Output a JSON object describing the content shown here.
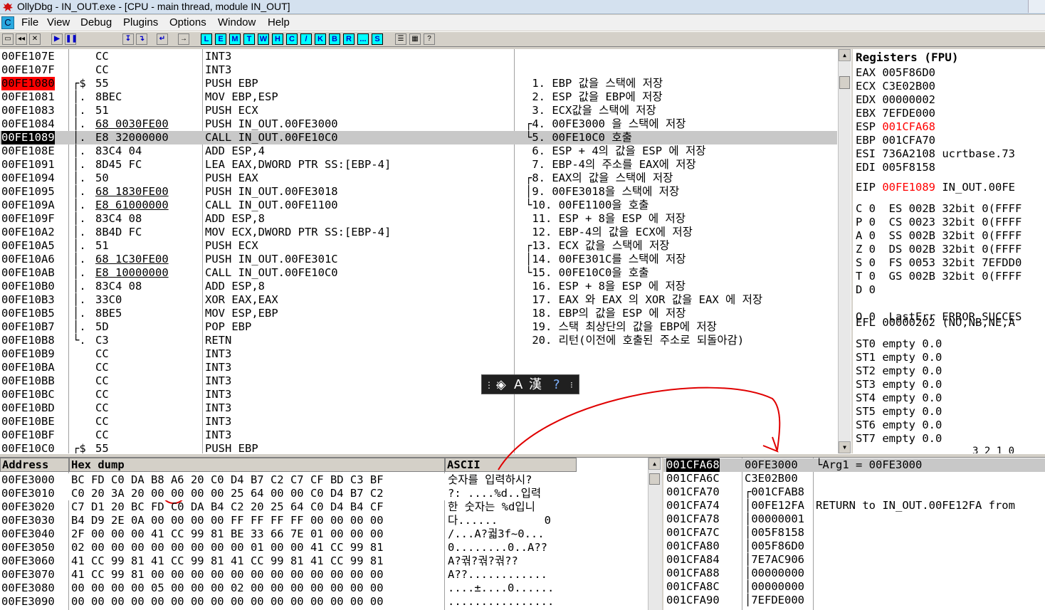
{
  "window": {
    "title": "OllyDbg - IN_OUT.exe - [CPU - main thread, module IN_OUT]"
  },
  "menu": [
    "File",
    "View",
    "Debug",
    "Plugins",
    "Options",
    "Window",
    "Help"
  ],
  "menu_cpu_label": "C",
  "toolbar_letters": [
    "L",
    "E",
    "M",
    "T",
    "W",
    "H",
    "C",
    "/",
    "K",
    "B",
    "R",
    "...",
    "S"
  ],
  "toolbar_tail": [
    "?"
  ],
  "disasm": [
    {
      "addr": "00FE107E",
      "mark": "",
      "hex": "CC",
      "dis": "INT3",
      "cmt": ""
    },
    {
      "addr": "00FE107F",
      "mark": "",
      "hex": "CC",
      "dis": "INT3",
      "cmt": ""
    },
    {
      "addr": "00FE1080",
      "mark": "┌$",
      "hex": "55",
      "dis": "PUSH EBP",
      "cmt": " 1. EBP 값을 스택에 저장"
    },
    {
      "addr": "00FE1081",
      "mark": "│.",
      "hex": "8BEC",
      "dis": "MOV EBP,ESP",
      "cmt": " 2. ESP 값을 EBP에 저장"
    },
    {
      "addr": "00FE1083",
      "mark": "│.",
      "hex": "51",
      "dis": "PUSH ECX",
      "cmt": " 3. ECX값을 스택에 저장"
    },
    {
      "addr": "00FE1084",
      "mark": "│.",
      "hex": "68 0030FE00",
      "dis": "PUSH IN_OUT.00FE3000",
      "cmt": "┌4. 00FE3000 을 스택에 저장"
    },
    {
      "addr": "00FE1089",
      "mark": "│.",
      "hex": "E8 32000000",
      "dis": "CALL IN_OUT.00FE10C0",
      "cmt": "└5. 00FE10C0 호출"
    },
    {
      "addr": "00FE108E",
      "mark": "│.",
      "hex": "83C4 04",
      "dis": "ADD ESP,4",
      "cmt": " 6. ESP + 4의 값을 ESP 에 저장"
    },
    {
      "addr": "00FE1091",
      "mark": "│.",
      "hex": "8D45 FC",
      "dis": "LEA EAX,DWORD PTR SS:[EBP-4]",
      "cmt": " 7. EBP-4의 주소를 EAX에 저장"
    },
    {
      "addr": "00FE1094",
      "mark": "│.",
      "hex": "50",
      "dis": "PUSH EAX",
      "cmt": "┌8. EAX의 값을 스택에 저장"
    },
    {
      "addr": "00FE1095",
      "mark": "│.",
      "hex": "68 1830FE00",
      "dis": "PUSH IN_OUT.00FE3018",
      "cmt": "│9. 00FE3018을 스택에 저장"
    },
    {
      "addr": "00FE109A",
      "mark": "│.",
      "hex": "E8 61000000",
      "dis": "CALL IN_OUT.00FE1100",
      "cmt": "└10. 00FE1100을 호출"
    },
    {
      "addr": "00FE109F",
      "mark": "│.",
      "hex": "83C4 08",
      "dis": "ADD ESP,8",
      "cmt": " 11. ESP + 8을 ESP 에 저장"
    },
    {
      "addr": "00FE10A2",
      "mark": "│.",
      "hex": "8B4D FC",
      "dis": "MOV ECX,DWORD PTR SS:[EBP-4]",
      "cmt": " 12. EBP-4의 값을 ECX에 저장"
    },
    {
      "addr": "00FE10A5",
      "mark": "│.",
      "hex": "51",
      "dis": "PUSH ECX",
      "cmt": "┌13. ECX 값을 스택에 저장"
    },
    {
      "addr": "00FE10A6",
      "mark": "│.",
      "hex": "68 1C30FE00",
      "dis": "PUSH IN_OUT.00FE301C",
      "cmt": "│14. 00FE301C를 스택에 저장"
    },
    {
      "addr": "00FE10AB",
      "mark": "│.",
      "hex": "E8 10000000",
      "dis": "CALL IN_OUT.00FE10C0",
      "cmt": "└15. 00FE10C0을 호출"
    },
    {
      "addr": "00FE10B0",
      "mark": "│.",
      "hex": "83C4 08",
      "dis": "ADD ESP,8",
      "cmt": " 16. ESP + 8을 ESP 에 저장"
    },
    {
      "addr": "00FE10B3",
      "mark": "│.",
      "hex": "33C0",
      "dis": "XOR EAX,EAX",
      "cmt": " 17. EAX 와 EAX 의 XOR 값을 EAX 에 저장"
    },
    {
      "addr": "00FE10B5",
      "mark": "│.",
      "hex": "8BE5",
      "dis": "MOV ESP,EBP",
      "cmt": " 18. EBP의 값을 ESP 에 저장"
    },
    {
      "addr": "00FE10B7",
      "mark": "│.",
      "hex": "5D",
      "dis": "POP EBP",
      "cmt": " 19. 스택 최상단의 값을 EBP에 저장"
    },
    {
      "addr": "00FE10B8",
      "mark": "└.",
      "hex": "C3",
      "dis": "RETN",
      "cmt": " 20. 리턴(이전에 호출된 주소로 되돌아감)"
    },
    {
      "addr": "00FE10B9",
      "mark": "",
      "hex": "CC",
      "dis": "INT3",
      "cmt": ""
    },
    {
      "addr": "00FE10BA",
      "mark": "",
      "hex": "CC",
      "dis": "INT3",
      "cmt": ""
    },
    {
      "addr": "00FE10BB",
      "mark": "",
      "hex": "CC",
      "dis": "INT3",
      "cmt": ""
    },
    {
      "addr": "00FE10BC",
      "mark": "",
      "hex": "CC",
      "dis": "INT3",
      "cmt": ""
    },
    {
      "addr": "00FE10BD",
      "mark": "",
      "hex": "CC",
      "dis": "INT3",
      "cmt": ""
    },
    {
      "addr": "00FE10BE",
      "mark": "",
      "hex": "CC",
      "dis": "INT3",
      "cmt": ""
    },
    {
      "addr": "00FE10BF",
      "mark": "",
      "hex": "CC",
      "dis": "INT3",
      "cmt": ""
    },
    {
      "addr": "00FE10C0",
      "mark": "┌$",
      "hex": "55",
      "dis": "PUSH EBP",
      "cmt": ""
    }
  ],
  "registers": {
    "title": "Registers (FPU)",
    "gp": [
      {
        "name": "EAX",
        "value": "005F86D0",
        "extra": "",
        "changed": false
      },
      {
        "name": "ECX",
        "value": "C3E02B00",
        "extra": "",
        "changed": false
      },
      {
        "name": "EDX",
        "value": "00000002",
        "extra": "",
        "changed": false
      },
      {
        "name": "EBX",
        "value": "7EFDE000",
        "extra": "",
        "changed": false
      },
      {
        "name": "ESP",
        "value": "001CFA68",
        "extra": "",
        "changed": true
      },
      {
        "name": "EBP",
        "value": "001CFA70",
        "extra": "",
        "changed": false
      },
      {
        "name": "ESI",
        "value": "736A2108",
        "extra": "ucrtbase.73",
        "changed": false
      },
      {
        "name": "EDI",
        "value": "005F8158",
        "extra": "",
        "changed": false
      }
    ],
    "eip": {
      "name": "EIP",
      "value": "00FE1089",
      "extra": "IN_OUT.00FE"
    },
    "flags": [
      "C 0  ES 002B 32bit 0(FFFF",
      "P 0  CS 0023 32bit 0(FFFF",
      "A 0  SS 002B 32bit 0(FFFF",
      "Z 0  DS 002B 32bit 0(FFFF",
      "S 0  FS 0053 32bit 7EFDD0",
      "T 0  GS 002B 32bit 0(FFFF",
      "D 0",
      "O 0  LastErr ERROR_SUCCES"
    ],
    "efl": "EFL 00000202 (NO,NB,NE,A",
    "fpu": [
      "ST0 empty 0.0",
      "ST1 empty 0.0",
      "ST2 empty 0.0",
      "ST3 empty 0.0",
      "ST4 empty 0.0",
      "ST5 empty 0.0",
      "ST6 empty 0.0",
      "ST7 empty 0.0"
    ],
    "fpu_tail": "3 2 1 0"
  },
  "dump": {
    "headers": {
      "address": "Address",
      "hex": "Hex dump",
      "ascii": "ASCII"
    },
    "rows": [
      {
        "addr": "00FE3000",
        "hex": "BC FD C0 DA B8 A6 20 C0 D4 B7 C2 C7 CF BD C3 BF",
        "ascii": "숫자를 입력하시?"
      },
      {
        "addr": "00FE3010",
        "hex": "C0 20 3A 20 00 00 00 00 25 64 00 00 C0 D4 B7 C2",
        "ascii": "?: ....%d..입력"
      },
      {
        "addr": "00FE3020",
        "hex": "C7 D1 20 BC FD C0 DA B4 C2 20 25 64 C0 D4 B4 CF",
        "ascii": "한 숫자는 %d입니"
      },
      {
        "addr": "00FE3030",
        "hex": "B4 D9 2E 0A 00 00 00 00 FF FF FF FF 00 00 00 00",
        "ascii": "다......       0"
      },
      {
        "addr": "00FE3040",
        "hex": "2F 00 00 00 41 CC 99 81 BE 33 66 7E 01 00 00 00",
        "ascii": "/...A?궓3f~0..."
      },
      {
        "addr": "00FE3050",
        "hex": "02 00 00 00 00 00 00 00 00 01 00 00 41 CC 99 81",
        "ascii": "0........0..A??"
      },
      {
        "addr": "00FE3060",
        "hex": "41 CC 99 81 41 CC 99 81 41 CC 99 81 41 CC 99 81",
        "ascii": "A?궊?궊?궊??"
      },
      {
        "addr": "00FE3070",
        "hex": "41 CC 99 81 00 00 00 00 00 00 00 00 00 00 00 00",
        "ascii": "A??............"
      },
      {
        "addr": "00FE3080",
        "hex": "00 00 00 00 05 00 00 00 02 00 00 00 00 00 00 00",
        "ascii": "....±....0......"
      },
      {
        "addr": "00FE3090",
        "hex": "00 00 00 00 00 00 00 00 00 00 00 00 00 00 00 00",
        "ascii": "................"
      }
    ]
  },
  "stack": [
    {
      "addr": "001CFA68",
      "val": "00FE3000",
      "cmt": "└Arg1 = 00FE3000"
    },
    {
      "addr": "001CFA6C",
      "val": "C3E02B00",
      "cmt": ""
    },
    {
      "addr": "001CFA70",
      "val": "┌001CFAB8",
      "cmt": ""
    },
    {
      "addr": "001CFA74",
      "val": "│00FE12FA",
      "cmt": "RETURN to IN_OUT.00FE12FA from"
    },
    {
      "addr": "001CFA78",
      "val": "│00000001",
      "cmt": ""
    },
    {
      "addr": "001CFA7C",
      "val": "│005F8158",
      "cmt": ""
    },
    {
      "addr": "001CFA80",
      "val": "│005F86D0",
      "cmt": ""
    },
    {
      "addr": "001CFA84",
      "val": "│7E7AC906",
      "cmt": ""
    },
    {
      "addr": "001CFA88",
      "val": "│00000000",
      "cmt": ""
    },
    {
      "addr": "001CFA8C",
      "val": "│00000000",
      "cmt": ""
    },
    {
      "addr": "001CFA90",
      "val": "│7EFDE000",
      "cmt": ""
    }
  ],
  "ime": {
    "mode_label": "A",
    "hanja_label": "漢",
    "help_label": "?"
  },
  "colors": {
    "breakpoint": "#ff0000",
    "annotation": "#e00000",
    "selection": "#000000"
  }
}
